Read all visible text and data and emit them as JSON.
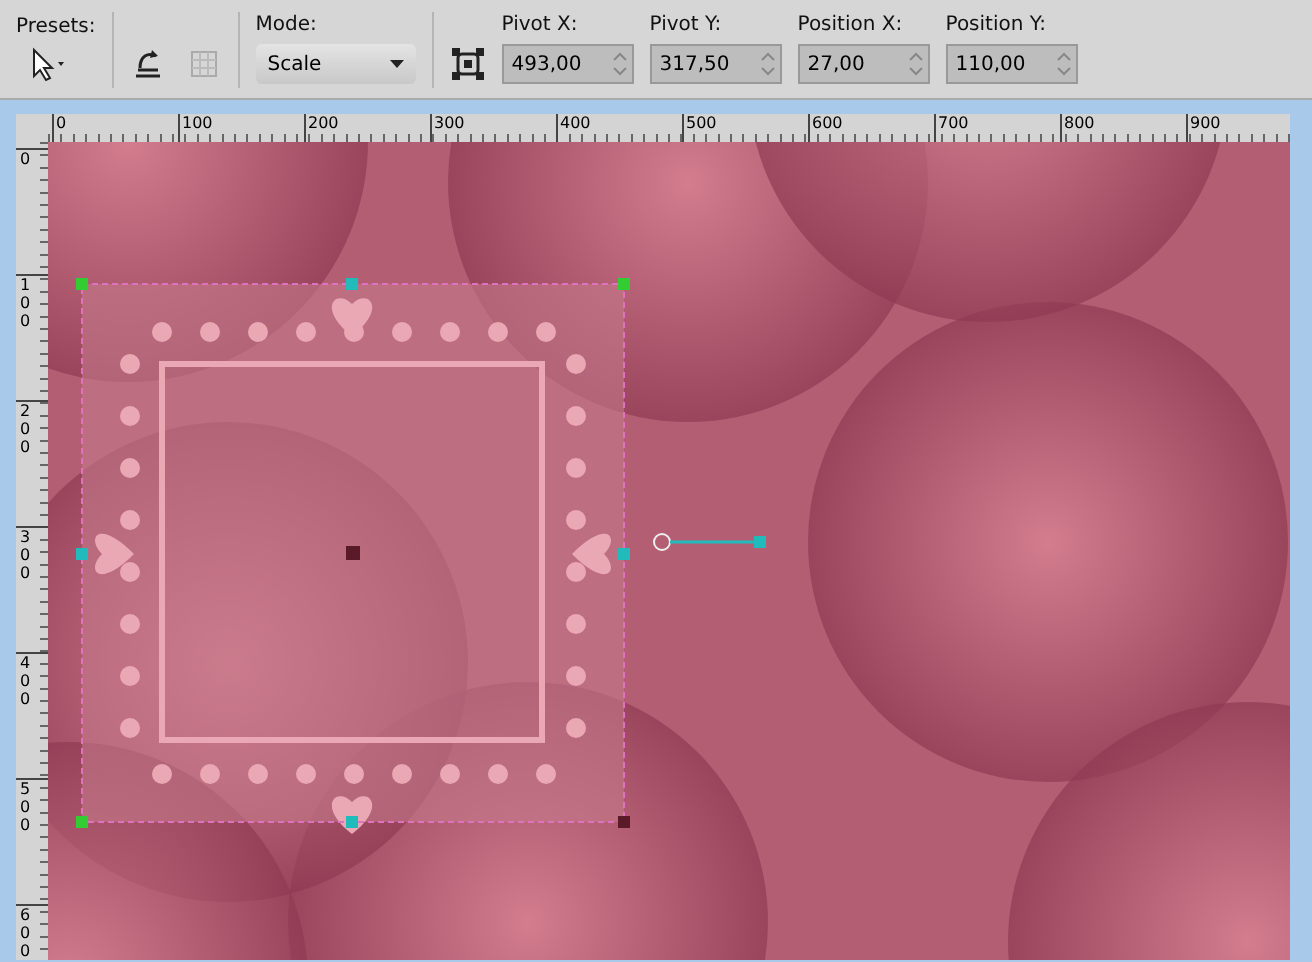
{
  "toolbar": {
    "presets": {
      "label": "Presets:"
    },
    "mode": {
      "label": "Mode:",
      "value": "Scale"
    },
    "fields": [
      {
        "label": "Pivot X:",
        "value": "493,00"
      },
      {
        "label": "Pivot Y:",
        "value": "317,50"
      },
      {
        "label": "Position X:",
        "value": "27,00"
      },
      {
        "label": "Position Y:",
        "value": "110,00"
      }
    ]
  },
  "rulers": {
    "horizontal": [
      "0",
      "100",
      "200",
      "300",
      "400",
      "500",
      "600",
      "700",
      "800",
      "900"
    ],
    "vertical": [
      "0",
      "100",
      "200",
      "300",
      "400",
      "500",
      "600"
    ]
  }
}
